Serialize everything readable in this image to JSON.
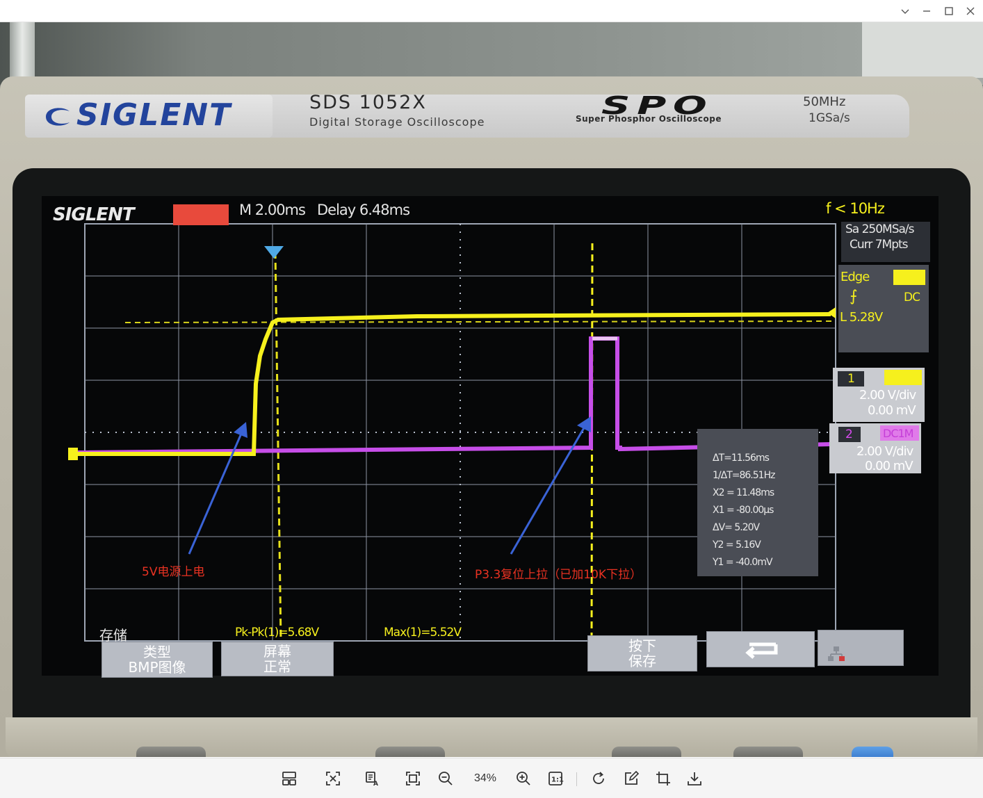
{
  "window": {
    "controls": [
      "chevron-down-icon",
      "minimize-icon",
      "maximize-icon",
      "close-icon"
    ]
  },
  "device": {
    "brand": "SIGLENT",
    "model": "SDS 1052X",
    "model_subtitle": "Digital Storage Oscilloscope",
    "series_logo": "SPO",
    "series_subtitle": "Super Phosphor Oscilloscope",
    "bandwidth": "50MHz",
    "sample_rate_spec": "1GSa/s"
  },
  "screen": {
    "logo": "SIGLENT",
    "timebase": "M 2.00ms",
    "delay": "Delay 6.48ms",
    "trigger_freq": "f < 10Hz",
    "acq": {
      "sa": "Sa 250MSa/s",
      "curr": "Curr 7Mpts"
    },
    "trigger": {
      "type": "Edge",
      "coupling": "DC",
      "level": "L  5.28V"
    },
    "ch1": {
      "num": "1",
      "scale": "2.00 V/div",
      "offset": "0.00 mV"
    },
    "ch2": {
      "num": "2",
      "coupling": "DC1M",
      "scale": "2.00 V/div",
      "offset": "0.00 mV"
    },
    "measure": {
      "dT": "ΔT=11.56ms",
      "inv_dT": "1/ΔT=86.51Hz",
      "x2": "X2 = 11.48ms",
      "x1": "X1 = -80.00µs",
      "dV": "ΔV= 5.20V",
      "y2": "Y2 = 5.16V",
      "y1": "Y1 = -40.0mV"
    },
    "bottom": {
      "menu_title": "存储",
      "pkpk": "Pk-Pk(1)=5.68V",
      "max": "Max(1)=5.52V",
      "btn1": [
        "类型",
        "BMP图像"
      ],
      "btn2": [
        "屏幕",
        "正常"
      ],
      "btn3": [
        "按下",
        "保存"
      ]
    },
    "annotations": {
      "left": "5V电源上电",
      "right": "P3.3复位上拉（已加10K下拉）"
    },
    "colors": {
      "ch1": "#f6f01d",
      "ch2": "#d84af0",
      "annotation": "#e93222",
      "arrow": "#3a63d6"
    }
  },
  "toolbar": {
    "zoom": "34%",
    "buttons": [
      "layout-icon",
      "fit-window-icon",
      "ocr-icon",
      "fullscreen-icon",
      "zoom-out-icon",
      "zoom-in-icon",
      "actual-size-icon",
      "rotate-icon",
      "edit-icon",
      "crop-icon",
      "download-icon"
    ],
    "one_to_one": "1:1"
  }
}
